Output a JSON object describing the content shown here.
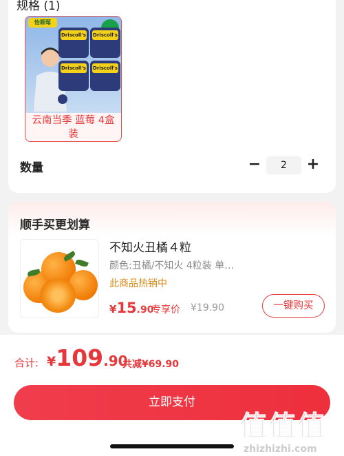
{
  "spec": {
    "title": "规格 (1)",
    "option": {
      "brand": "怡颗莓",
      "label": "云南当季 蓝莓 4盒装",
      "box_label": "Driscoll's"
    }
  },
  "quantity": {
    "label": "数量",
    "minus": "−",
    "value": "2",
    "plus": "+"
  },
  "bundle": {
    "title": "顺手买更划算",
    "item": {
      "name": "不知火丑橘４粒",
      "spec": "颜色:丑橘/不知火 4粒装 单…",
      "hot": "此商品热销中",
      "price_currency": "¥",
      "price_int": "15",
      "price_dec": ".90",
      "exclusive": "专享价",
      "original_price": "¥19.90",
      "buy_label": "一键购买"
    }
  },
  "checkout": {
    "total_label": "合计:",
    "currency": "¥",
    "total_int": "109",
    "total_dec": ".90",
    "discount": "共减¥69.90",
    "pay_label": "立即支付"
  },
  "watermark": {
    "big": "值值值",
    "small": "zhizhizhi.com"
  },
  "colors": {
    "accent": "#e5383b",
    "hot": "#d68a18"
  }
}
